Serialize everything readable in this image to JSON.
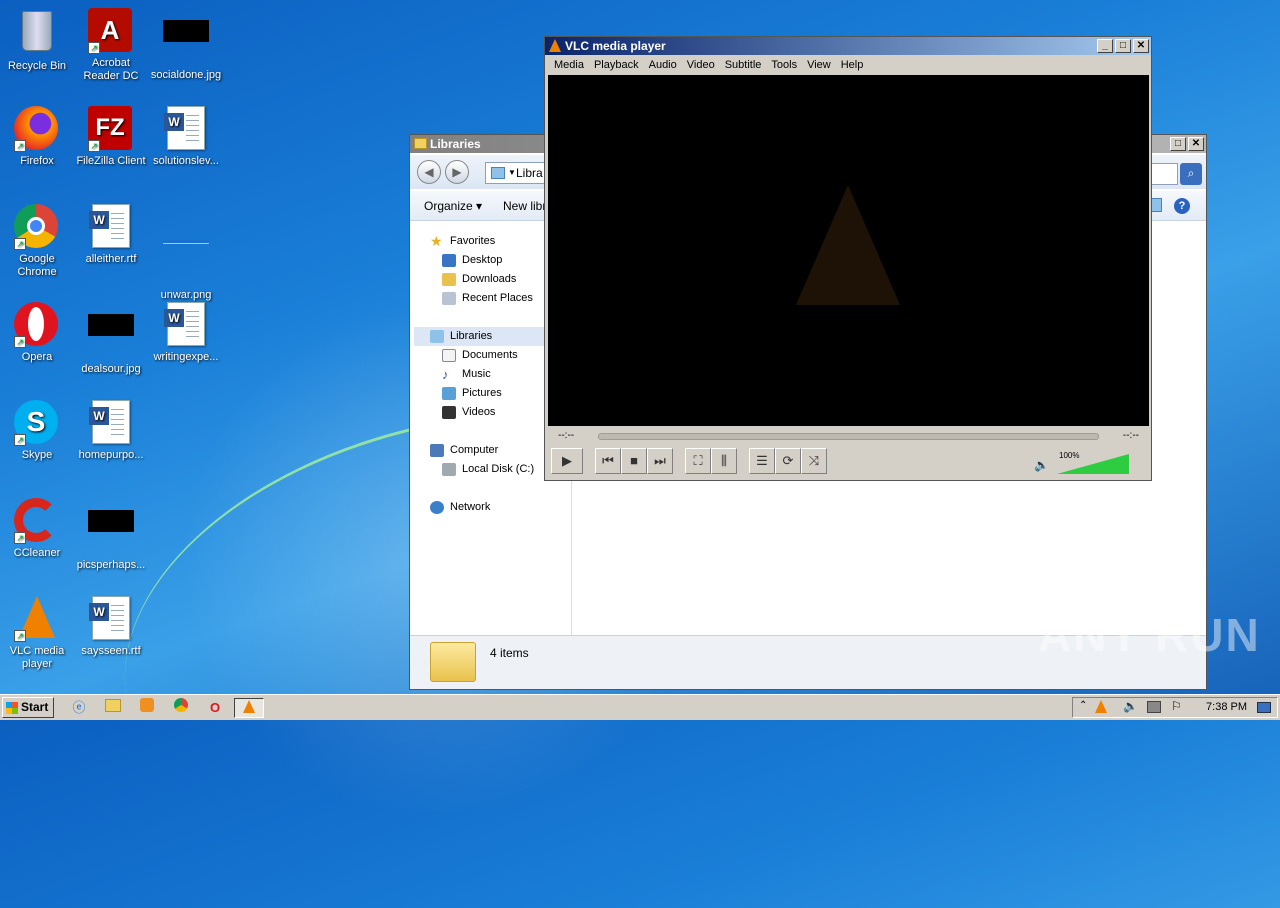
{
  "desktop": {
    "icons": [
      {
        "label": "Recycle Bin"
      },
      {
        "label": "Acrobat Reader DC"
      },
      {
        "label": "socialdone.jpg"
      },
      {
        "label": "Firefox"
      },
      {
        "label": "FileZilla Client"
      },
      {
        "label": "solutionslev..."
      },
      {
        "label": "Google Chrome"
      },
      {
        "label": "alleither.rtf"
      },
      {
        "label": "unwar.png"
      },
      {
        "label": "Opera"
      },
      {
        "label": "dealsour.jpg"
      },
      {
        "label": "writingexpe..."
      },
      {
        "label": "Skype"
      },
      {
        "label": "homepurpo..."
      },
      {
        "label": "CCleaner"
      },
      {
        "label": "picsperhaps..."
      },
      {
        "label": "VLC media player"
      },
      {
        "label": "saysseen.rtf"
      }
    ]
  },
  "explorer": {
    "title": "Libraries",
    "address": "Libra",
    "toolbar": {
      "organize": "Organize",
      "new_library": "New libra"
    },
    "nav": {
      "favorites": "Favorites",
      "desktop": "Desktop",
      "downloads": "Downloads",
      "recent": "Recent Places",
      "libraries": "Libraries",
      "documents": "Documents",
      "music": "Music",
      "pictures": "Pictures",
      "videos": "Videos",
      "computer": "Computer",
      "local_disk": "Local Disk (C:)",
      "network": "Network"
    },
    "status": "4 items"
  },
  "vlc": {
    "title": "VLC media player",
    "menu": [
      "Media",
      "Playback",
      "Audio",
      "Video",
      "Subtitle",
      "Tools",
      "View",
      "Help"
    ],
    "time_elapsed": "--:--",
    "time_total": "--:--",
    "volume": "100%",
    "volume_level": 1.0
  },
  "taskbar": {
    "start": "Start",
    "clock": "7:38 PM"
  },
  "watermark": "ANY RUN"
}
